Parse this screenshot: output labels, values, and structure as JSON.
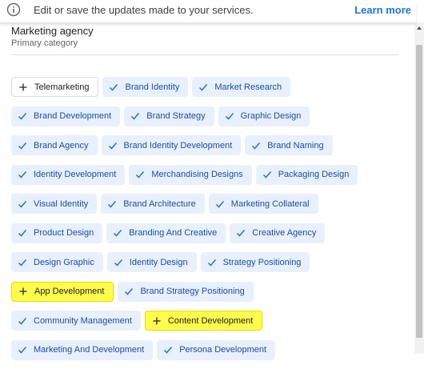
{
  "banner": {
    "text": "Edit or save the updates made to your services.",
    "link_label": "Learn more",
    "icon": "info-icon"
  },
  "category": {
    "name": "Marketing agency",
    "subtitle": "Primary category"
  },
  "colors": {
    "chip_selected_bg": "#e8f0fe",
    "chip_selected_text": "#174ea6",
    "highlight": "#fffb4c",
    "link": "#1a73e8"
  },
  "services": [
    [
      {
        "label": "Telemarketing",
        "state": "suggested"
      },
      {
        "label": "Brand Identity",
        "state": "selected"
      },
      {
        "label": "Market Research",
        "state": "selected"
      }
    ],
    [
      {
        "label": "Brand Development",
        "state": "selected"
      },
      {
        "label": "Brand Strategy",
        "state": "selected"
      },
      {
        "label": "Graphic Design",
        "state": "selected"
      }
    ],
    [
      {
        "label": "Brand Agency",
        "state": "selected"
      },
      {
        "label": "Brand Identity Development",
        "state": "selected"
      },
      {
        "label": "Brand Naming",
        "state": "selected"
      }
    ],
    [
      {
        "label": "Identity Development",
        "state": "selected"
      },
      {
        "label": "Merchandising Designs",
        "state": "selected"
      },
      {
        "label": "Packaging Design",
        "state": "selected"
      }
    ],
    [
      {
        "label": "Visual Identity",
        "state": "selected"
      },
      {
        "label": "Brand Architecture",
        "state": "selected"
      },
      {
        "label": "Marketing Collateral",
        "state": "selected"
      }
    ],
    [
      {
        "label": "Product Design",
        "state": "selected"
      },
      {
        "label": "Branding And Creative",
        "state": "selected"
      },
      {
        "label": "Creative Agency",
        "state": "selected"
      }
    ],
    [
      {
        "label": "Design Graphic",
        "state": "selected"
      },
      {
        "label": "Identity Design",
        "state": "selected"
      },
      {
        "label": "Strategy Positioning",
        "state": "selected"
      }
    ],
    [
      {
        "label": "App Development",
        "state": "highlight"
      },
      {
        "label": "Brand Strategy Positioning",
        "state": "selected"
      }
    ],
    [
      {
        "label": "Community Management",
        "state": "selected"
      },
      {
        "label": "Content Development",
        "state": "highlight"
      }
    ],
    [
      {
        "label": "Marketing And Development",
        "state": "selected"
      },
      {
        "label": "Persona Development",
        "state": "selected"
      }
    ]
  ]
}
